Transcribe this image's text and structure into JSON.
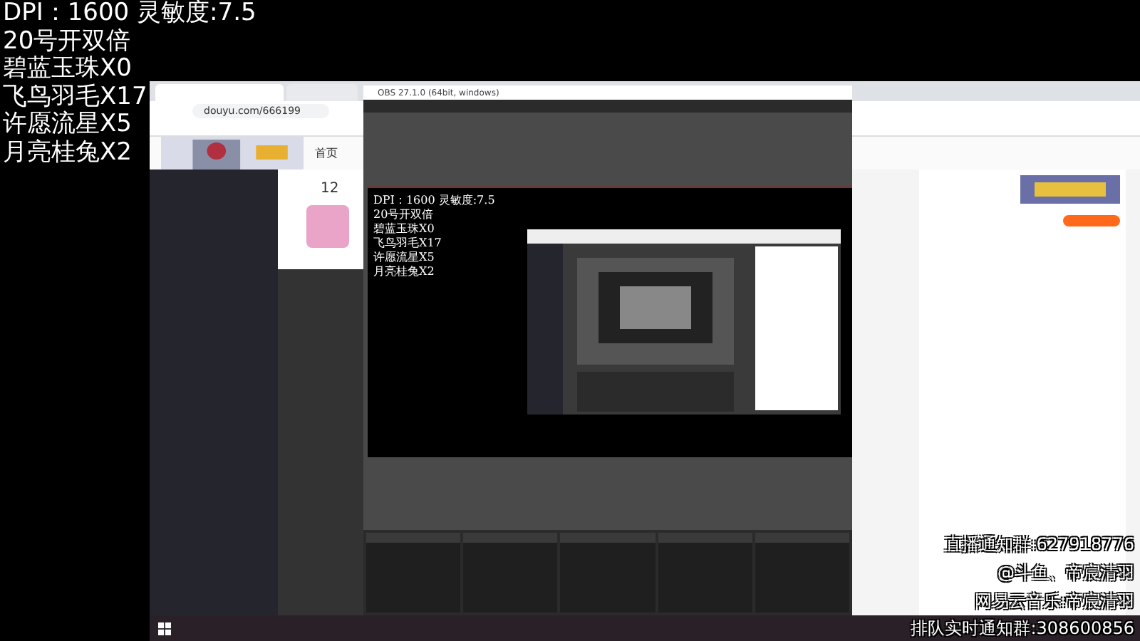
{
  "stream_overlay": {
    "lines": [
      "DPI：1600 灵敏度:7.5",
      "20号开双倍",
      "碧蓝玉珠X0",
      "飞鸟羽毛X17",
      "许愿流星X5",
      "月亮桂兔X2"
    ]
  },
  "browser": {
    "url": "douyu.com/666199",
    "nav_home": "首页",
    "follow_count": "12"
  },
  "obs": {
    "title": "OBS 27.1.0 (64bit, windows)",
    "preview_lines": [
      "DPI：1600 灵敏度:7.5",
      "20号开双倍",
      "碧蓝玉珠X0",
      "飞鸟羽毛X17",
      "许愿流星X5",
      "月亮桂兔X2"
    ]
  },
  "info_overlay": {
    "lines": [
      "直播通知群:627918776",
      "@斗鱼、帝宸清羽",
      "网易云音乐:帝宸清羽",
      "排队实时通知群:308600856"
    ]
  }
}
